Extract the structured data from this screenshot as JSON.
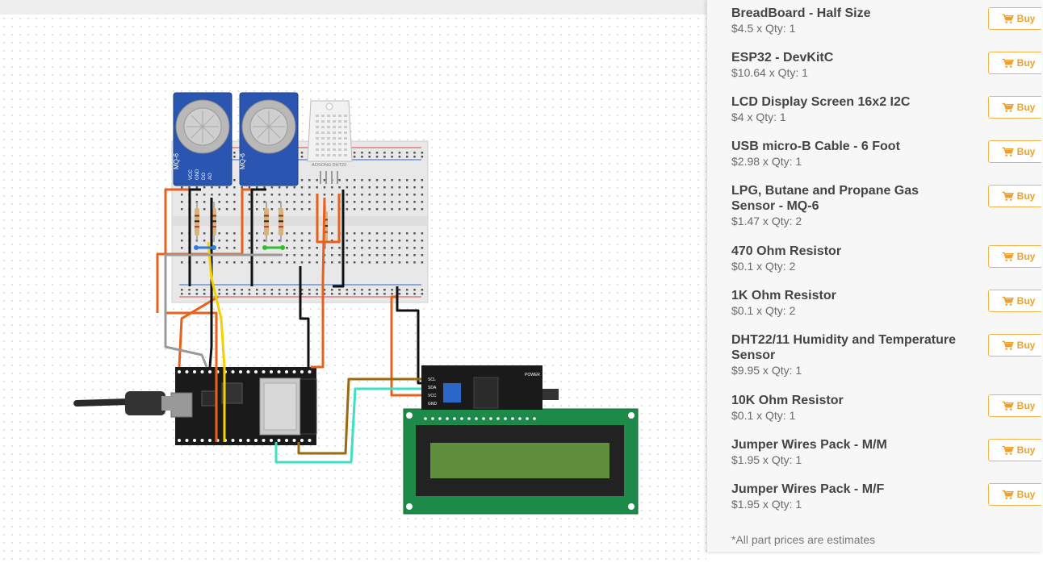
{
  "parts_panel": {
    "items": [
      {
        "name": "BreadBoard - Half Size",
        "price": "$4.5 x Qty: 1",
        "buy_label": "Buy"
      },
      {
        "name": "ESP32 - DevKitC",
        "price": "$10.64 x Qty: 1",
        "buy_label": "Buy"
      },
      {
        "name": "LCD Display Screen 16x2 I2C",
        "price": "$4 x Qty: 1",
        "buy_label": "Buy"
      },
      {
        "name": "USB micro-B Cable - 6 Foot",
        "price": "$2.98 x Qty: 1",
        "buy_label": "Buy"
      },
      {
        "name": "LPG, Butane and Propane Gas Sensor - MQ-6",
        "price": "$1.47 x Qty: 2",
        "buy_label": "Buy"
      },
      {
        "name": "470 Ohm Resistor",
        "price": "$0.1 x Qty: 2",
        "buy_label": "Buy"
      },
      {
        "name": "1K Ohm Resistor",
        "price": "$0.1 x Qty: 2",
        "buy_label": "Buy"
      },
      {
        "name": "DHT22/11 Humidity and Temperature Sensor",
        "price": "$9.95 x Qty: 1",
        "buy_label": "Buy"
      },
      {
        "name": "10K Ohm Resistor",
        "price": "$0.1 x Qty: 1",
        "buy_label": "Buy"
      },
      {
        "name": "Jumper Wires Pack - M/M",
        "price": "$1.95 x Qty: 1",
        "buy_label": "Buy"
      },
      {
        "name": "Jumper Wires Pack - M/F",
        "price": "$1.95 x Qty: 1",
        "buy_label": "Buy"
      }
    ],
    "footnote": "*All part prices are estimates",
    "buy_icon": "shopping-cart-icon",
    "accent_color": "#f0a02a"
  },
  "circuit": {
    "sensor_1_label": "MQ-6",
    "sensor_2_label": "MQ-6",
    "sensor_pins": [
      "VCC",
      "GND",
      "DO",
      "AO"
    ],
    "dht_label": "AOSONG DHT22",
    "lcd_pins": [
      "SCL",
      "SDA",
      "VCC",
      "GND"
    ],
    "lcd_module_label": "POWER"
  }
}
